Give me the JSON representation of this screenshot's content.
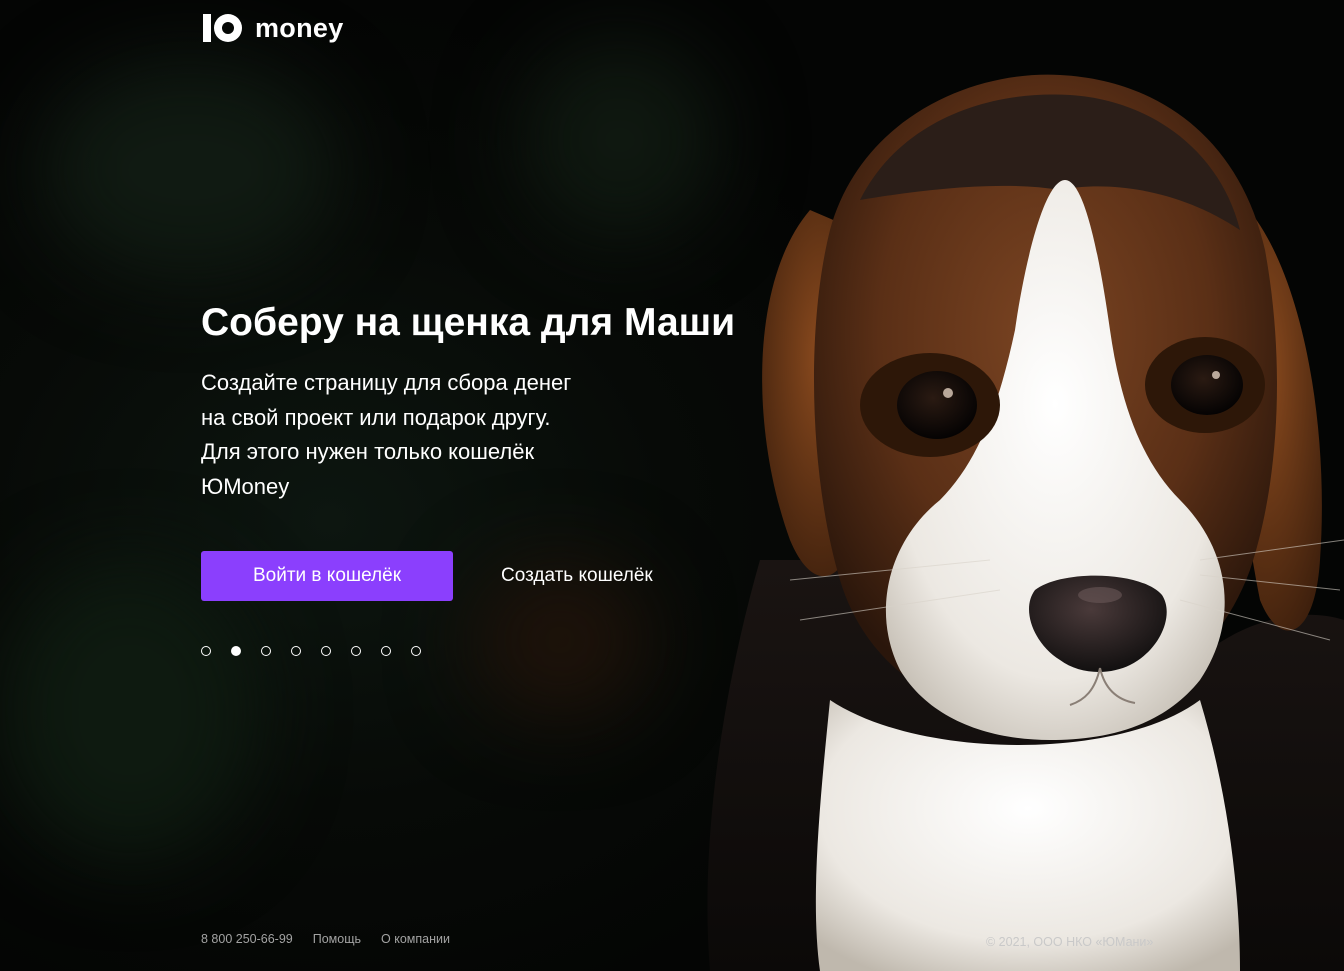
{
  "brand": {
    "logo_text": "money",
    "logo_icon": "yumoney-logo-icon"
  },
  "hero": {
    "title": "Соберу на щенка для Маши",
    "description_lines": [
      "Создайте страницу для сбора денег",
      "на свой проект или подарок другу.",
      "Для этого нужен только кошелёк",
      "ЮMoney"
    ]
  },
  "actions": {
    "login_label": "Войти в кошелёк",
    "create_label": "Создать кошелёк"
  },
  "carousel": {
    "count": 8,
    "active_index": 1
  },
  "footer": {
    "phone": "8 800 250-66-99",
    "help_label": "Помощь",
    "about_label": "О компании",
    "copyright": "© 2021, ООО НКО «ЮМани»"
  },
  "colors": {
    "accent": "#8b3ffd",
    "background": "#050705",
    "text": "#ffffff",
    "footer_text": "#a3a3a3"
  }
}
